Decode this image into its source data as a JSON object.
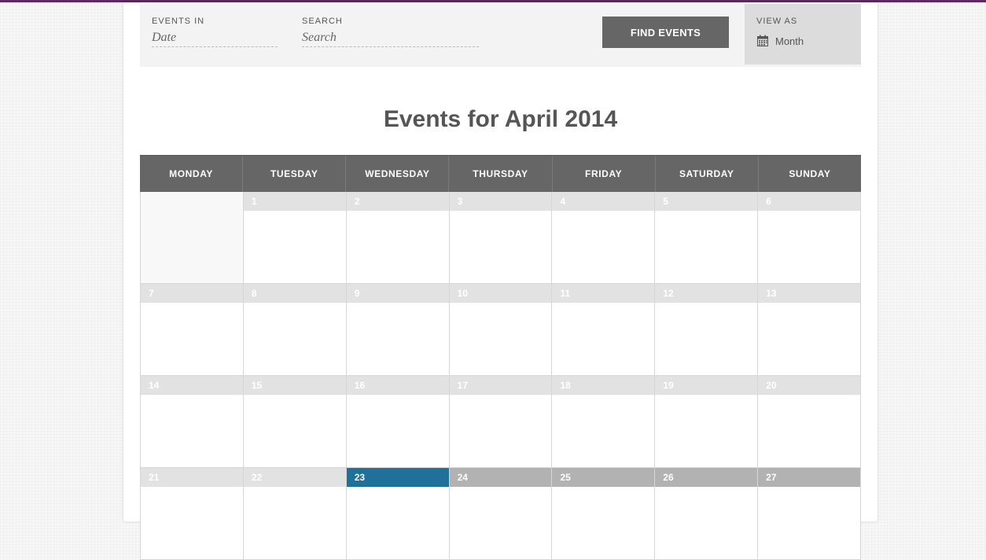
{
  "filter": {
    "events_in_label": "EVENTS IN",
    "date_placeholder": "Date",
    "search_label": "SEARCH",
    "search_placeholder": "Search",
    "find_button": "FIND EVENTS",
    "view_as_label": "VIEW AS",
    "view_selected": "Month",
    "view_icon": "calendar-icon"
  },
  "title": "Events for April 2014",
  "weekdays": [
    "MONDAY",
    "TUESDAY",
    "WEDNESDAY",
    "THURSDAY",
    "FRIDAY",
    "SATURDAY",
    "SUNDAY"
  ],
  "weeks": [
    [
      "",
      "1",
      "2",
      "3",
      "4",
      "5",
      "6"
    ],
    [
      "7",
      "8",
      "9",
      "10",
      "11",
      "12",
      "13"
    ],
    [
      "14",
      "15",
      "16",
      "17",
      "18",
      "19",
      "20"
    ],
    [
      "21",
      "22",
      "23",
      "24",
      "25",
      "26",
      "27"
    ]
  ],
  "today": "23",
  "colors": {
    "topbar": "#5b2a5e",
    "today_header": "#1f7199",
    "future_header": "#b2b2b2",
    "past_header": "#e2e2e2",
    "weekday_bar": "#666666"
  }
}
